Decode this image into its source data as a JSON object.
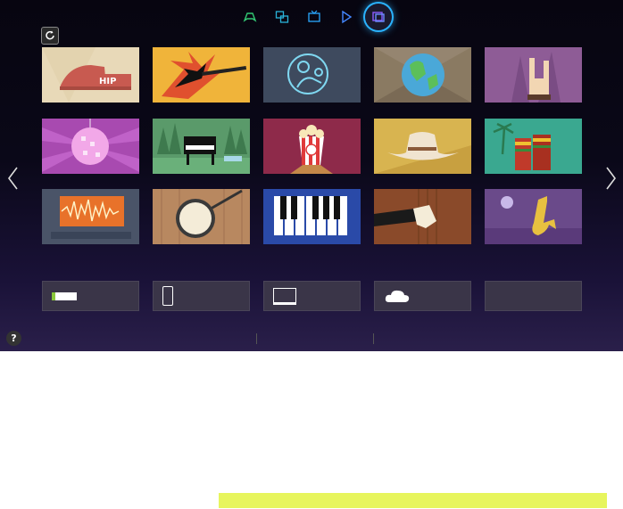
{
  "topnav": {
    "items": [
      {
        "name": "game-icon",
        "label": "",
        "color": "#32c873"
      },
      {
        "name": "multi-screen-icon",
        "label": "",
        "color": "#2ab3d9"
      },
      {
        "name": "tv-icon",
        "label": "",
        "color": "#2aa8ff"
      },
      {
        "name": "play-icon",
        "label": "",
        "color": "#4488ff"
      },
      {
        "name": "gallery-icon",
        "label": "",
        "color": "#8b5cff",
        "active": true
      }
    ]
  },
  "help": {
    "symbol": "?"
  },
  "tiles": [
    {
      "name": "hip-hop-tile",
      "label": "HIP"
    },
    {
      "name": "rock-guitar-tile",
      "label": ""
    },
    {
      "name": "singer-neon-tile",
      "label": ""
    },
    {
      "name": "world-globe-tile",
      "label": ""
    },
    {
      "name": "rock-hand-tile",
      "label": ""
    },
    {
      "name": "disco-ball-tile",
      "label": ""
    },
    {
      "name": "piano-forest-tile",
      "label": ""
    },
    {
      "name": "popcorn-tile",
      "label": ""
    },
    {
      "name": "cowboy-hat-tile",
      "label": ""
    },
    {
      "name": "bongo-drums-tile",
      "label": ""
    },
    {
      "name": "sound-wave-tile",
      "label": ""
    },
    {
      "name": "banjo-tile",
      "label": ""
    },
    {
      "name": "keyboard-tile",
      "label": ""
    },
    {
      "name": "double-bass-tile",
      "label": ""
    },
    {
      "name": "saxophone-tile",
      "label": ""
    }
  ],
  "devices": [
    {
      "name": "usb-device",
      "icon": "usb-icon",
      "label": ""
    },
    {
      "name": "phone-device",
      "icon": "phone-icon",
      "label": ""
    },
    {
      "name": "pc-device",
      "icon": "monitor-icon",
      "label": ""
    },
    {
      "name": "cloud-device",
      "icon": "cloud-icon",
      "label": ""
    },
    {
      "name": "empty-device",
      "icon": "",
      "label": ""
    }
  ]
}
